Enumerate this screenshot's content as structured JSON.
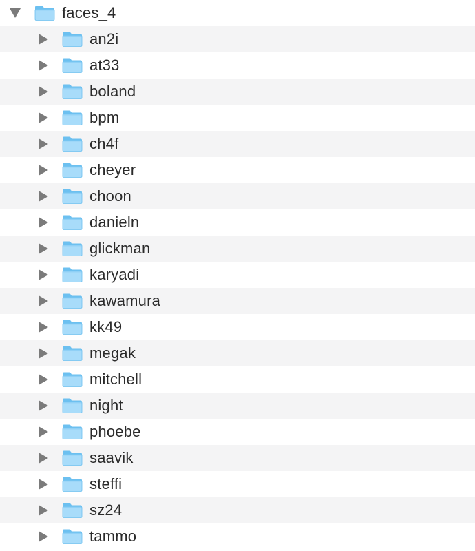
{
  "root": {
    "label": "faces_4",
    "state": "expanded",
    "icon": "folder-icon"
  },
  "children": [
    {
      "label": "an2i",
      "state": "collapsed",
      "icon": "folder-icon"
    },
    {
      "label": "at33",
      "state": "collapsed",
      "icon": "folder-icon"
    },
    {
      "label": "boland",
      "state": "collapsed",
      "icon": "folder-icon"
    },
    {
      "label": "bpm",
      "state": "collapsed",
      "icon": "folder-icon"
    },
    {
      "label": "ch4f",
      "state": "collapsed",
      "icon": "folder-icon"
    },
    {
      "label": "cheyer",
      "state": "collapsed",
      "icon": "folder-icon"
    },
    {
      "label": "choon",
      "state": "collapsed",
      "icon": "folder-icon"
    },
    {
      "label": "danieln",
      "state": "collapsed",
      "icon": "folder-icon"
    },
    {
      "label": "glickman",
      "state": "collapsed",
      "icon": "folder-icon"
    },
    {
      "label": "karyadi",
      "state": "collapsed",
      "icon": "folder-icon"
    },
    {
      "label": "kawamura",
      "state": "collapsed",
      "icon": "folder-icon"
    },
    {
      "label": "kk49",
      "state": "collapsed",
      "icon": "folder-icon"
    },
    {
      "label": "megak",
      "state": "collapsed",
      "icon": "folder-icon"
    },
    {
      "label": "mitchell",
      "state": "collapsed",
      "icon": "folder-icon"
    },
    {
      "label": "night",
      "state": "collapsed",
      "icon": "folder-icon"
    },
    {
      "label": "phoebe",
      "state": "collapsed",
      "icon": "folder-icon"
    },
    {
      "label": "saavik",
      "state": "collapsed",
      "icon": "folder-icon"
    },
    {
      "label": "steffi",
      "state": "collapsed",
      "icon": "folder-icon"
    },
    {
      "label": "sz24",
      "state": "collapsed",
      "icon": "folder-icon"
    },
    {
      "label": "tammo",
      "state": "collapsed",
      "icon": "folder-icon"
    }
  ],
  "colors": {
    "folder_light": "#a8dcfa",
    "folder_dark": "#6cc0f0",
    "folder_tab": "#8fd0f6",
    "row_alt": "#f4f4f5",
    "disclosure": "#7b7b7b",
    "text": "#2b2b2b"
  }
}
